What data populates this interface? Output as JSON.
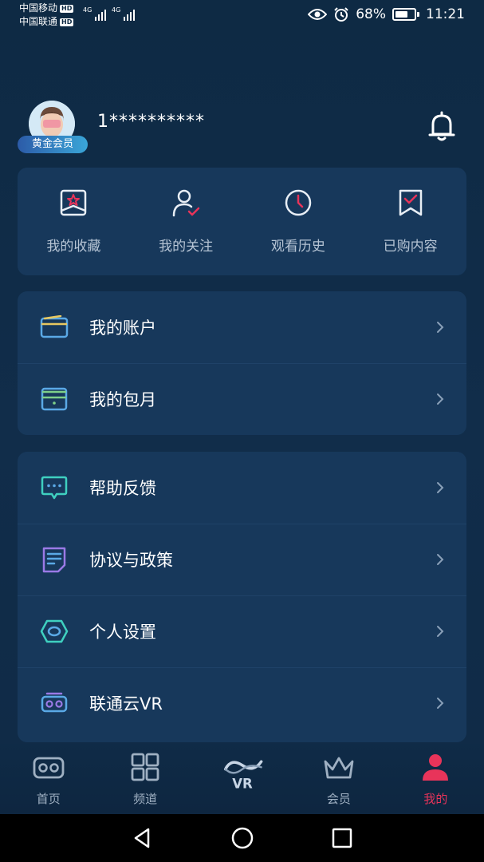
{
  "status_bar": {
    "carrier1": "中国移动",
    "carrier2": "中国联通",
    "hd": "HD",
    "net1": "4G",
    "net2": "4G",
    "battery": "68%",
    "time": "11:21"
  },
  "profile": {
    "username": "1**********",
    "member_badge": "黄金会员"
  },
  "quick_actions": [
    {
      "label": "我的收藏",
      "icon": "favorites-icon"
    },
    {
      "label": "我的关注",
      "icon": "follow-icon"
    },
    {
      "label": "观看历史",
      "icon": "history-icon"
    },
    {
      "label": "已购内容",
      "icon": "purchased-icon"
    }
  ],
  "menu_group1": [
    {
      "label": "我的账户",
      "icon": "wallet-icon"
    },
    {
      "label": "我的包月",
      "icon": "subscription-box-icon"
    }
  ],
  "menu_group2": [
    {
      "label": "帮助反馈",
      "icon": "chat-feedback-icon"
    },
    {
      "label": "协议与政策",
      "icon": "document-icon"
    },
    {
      "label": "个人设置",
      "icon": "hexagon-settings-icon"
    },
    {
      "label": "联通云VR",
      "icon": "vr-headset-icon"
    }
  ],
  "bottom_nav": [
    {
      "label": "首页",
      "icon": "vr-headset-icon"
    },
    {
      "label": "频道",
      "icon": "grid-icon"
    },
    {
      "label": "VR",
      "icon": "vr-logo-icon"
    },
    {
      "label": "会员",
      "icon": "crown-icon"
    },
    {
      "label": "我的",
      "icon": "person-icon",
      "active": true
    }
  ],
  "colors": {
    "background": "#0e2a44",
    "card": "#17385b",
    "accent": "#e8345a",
    "muted_text": "#b6c4d4"
  }
}
